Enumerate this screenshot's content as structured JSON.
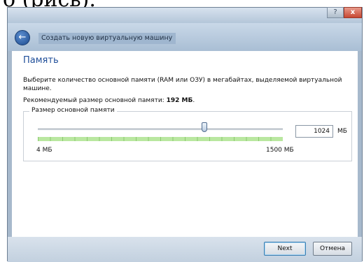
{
  "page_caption_fragment": "о (рись).",
  "window": {
    "help_button": "?",
    "close_button": "x",
    "title": "Создать новую виртуальную машину"
  },
  "content": {
    "heading": "Память",
    "description": "Выберите количество основной памяти (RAM или ОЗУ) в мегабайтах, выделяемой виртуальной машине.",
    "recommended_prefix": "Рекомендуемый размер основной памяти:",
    "recommended_value": "192 МБ",
    "recommended_suffix": "."
  },
  "memory": {
    "group_label": "Размер основной памяти",
    "value": "1024",
    "unit": "МБ",
    "min_label": "4 МБ",
    "max_label": "1500 МБ",
    "slider_fraction": 0.68
  },
  "footer": {
    "next_label": "Next",
    "cancel_label": "Отмена"
  },
  "colors": {
    "accent": "#1f4e99",
    "slider_fill": "#b9e7a0"
  }
}
